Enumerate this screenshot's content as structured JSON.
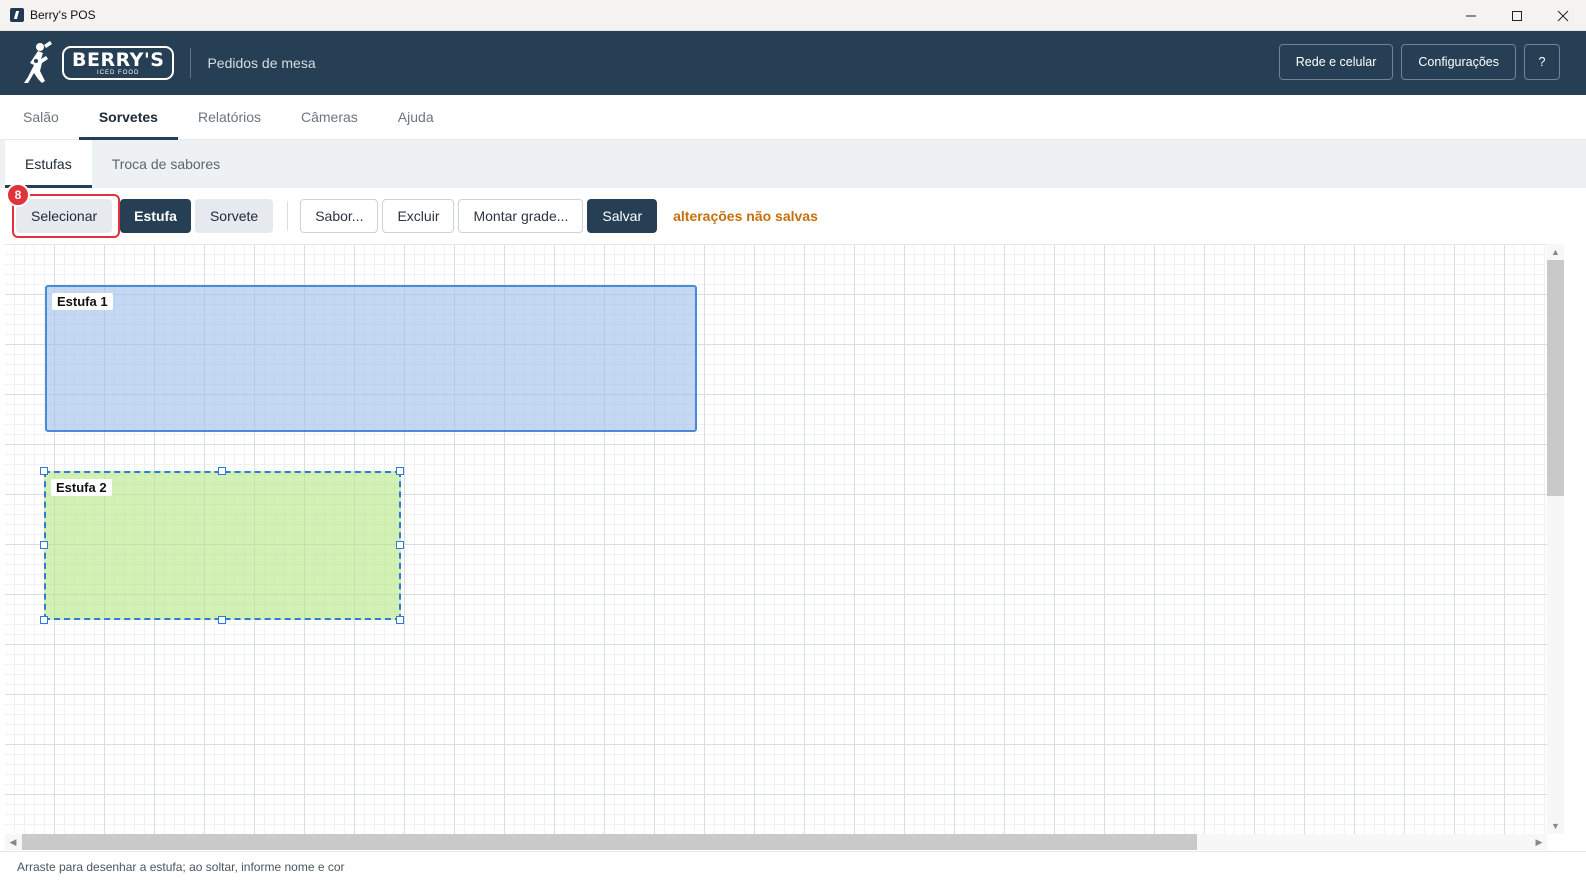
{
  "window": {
    "title": "Berry's POS"
  },
  "header": {
    "logo_text": "BERRY'S",
    "logo_tagline": "ICED FOOD",
    "subtitle": "Pedidos de mesa",
    "buttons": {
      "network": "Rede e celular",
      "settings": "Configurações",
      "help": "?"
    }
  },
  "main_tabs": [
    {
      "label": "Salão",
      "active": false
    },
    {
      "label": "Sorvetes",
      "active": true
    },
    {
      "label": "Relatórios",
      "active": false
    },
    {
      "label": "Câmeras",
      "active": false
    },
    {
      "label": "Ajuda",
      "active": false
    }
  ],
  "sub_tabs": [
    {
      "label": "Estufas",
      "active": true
    },
    {
      "label": "Troca de sabores",
      "active": false
    }
  ],
  "toolbar": {
    "mode_buttons": {
      "select": "Selecionar",
      "stove": "Estufa",
      "icecream": "Sorvete"
    },
    "active_mode": "stove",
    "highlight_badge": "8",
    "flavor": "Sabor...",
    "delete": "Excluir",
    "build_grid": "Montar grade...",
    "save": "Salvar",
    "unsaved_text": "alterações não salvas"
  },
  "canvas": {
    "stoves": [
      {
        "label": "Estufa 1",
        "color": "#9cbeeb",
        "selected": false
      },
      {
        "label": "Estufa 2",
        "color": "#b2e884",
        "selected": true
      }
    ]
  },
  "statusbar": {
    "hint": "Arraste para desenhar a estufa; ao soltar, informe nome e cor"
  },
  "colors": {
    "brand_dark": "#263f55",
    "warning": "#c5700a",
    "highlight_red": "#e2323a",
    "selection_blue": "#2f7ad8"
  }
}
